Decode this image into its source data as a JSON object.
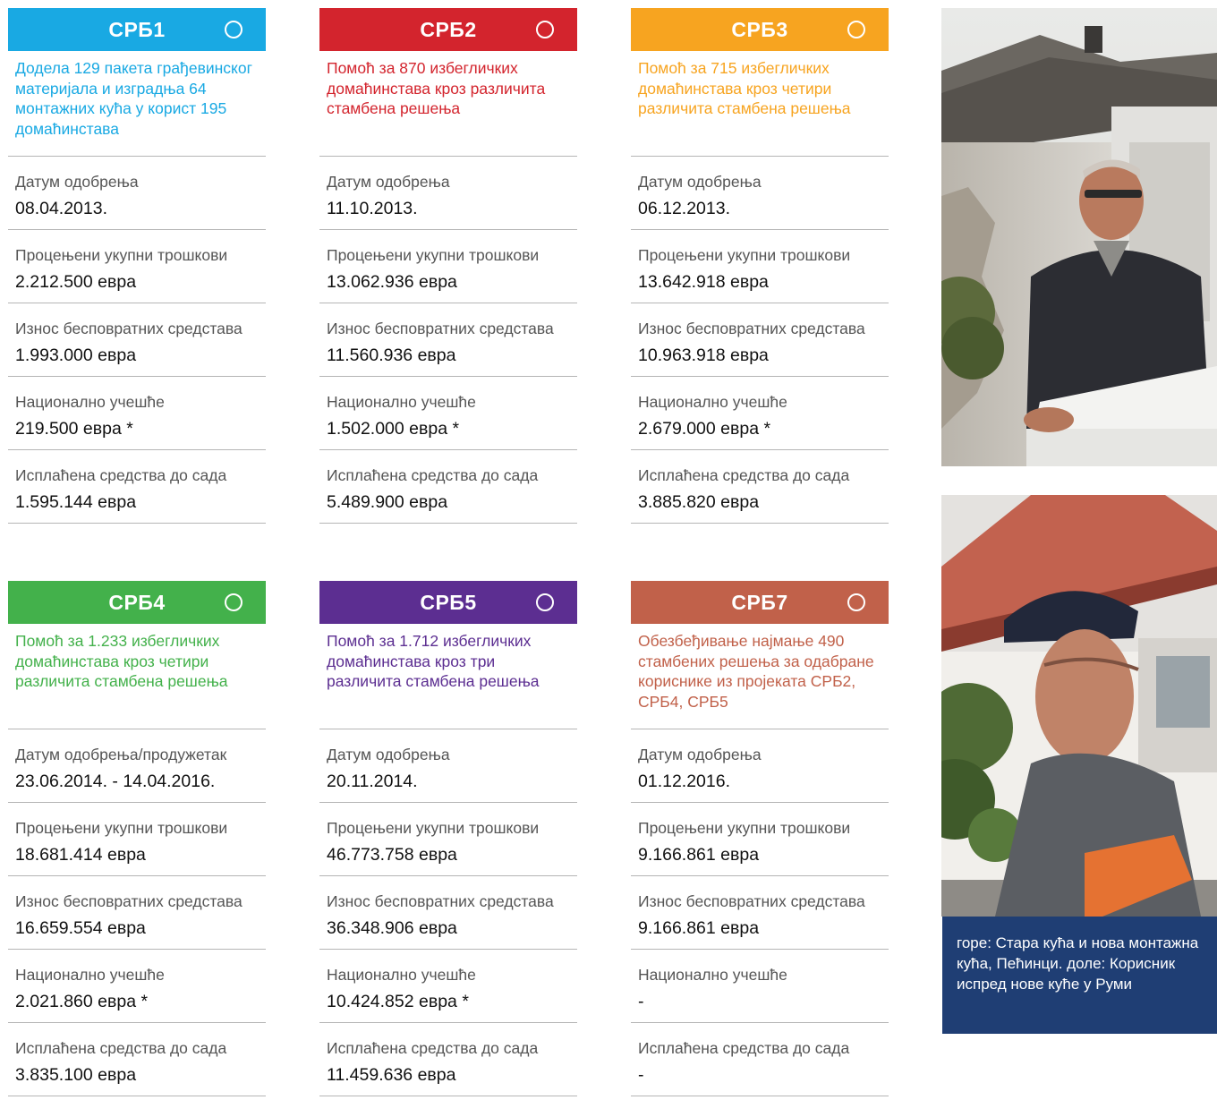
{
  "cards": [
    {
      "code": "СРБ1",
      "color": "#19a9e3",
      "description": "Додела 129 пакета грађевинског материјала и изградња 64 монтажних кућа у корист 195 домаћинстава",
      "fields": [
        {
          "label": "Датум одобрења",
          "value": "08.04.2013."
        },
        {
          "label": "Процењени укупни трошкови",
          "value": "2.212.500 евра"
        },
        {
          "label": "Износ бесповратних средстава",
          "value": "1.993.000 евра"
        },
        {
          "label": "Национално учешће",
          "value": "219.500 евра *"
        },
        {
          "label": "Исплаћена средства  до сада",
          "value": "1.595.144 евра"
        }
      ]
    },
    {
      "code": "СРБ2",
      "color": "#d3242d",
      "description": "Помоћ за 870 избегличких домаћинстава кроз различита стамбена решења",
      "fields": [
        {
          "label": "Датум одобрења",
          "value": "11.10.2013."
        },
        {
          "label": "Процењени укупни трошкови",
          "value": "13.062.936 евра"
        },
        {
          "label": "Износ бесповратних средстава",
          "value": "11.560.936 евра"
        },
        {
          "label": "Национално учешће",
          "value": "1.502.000 евра *"
        },
        {
          "label": "Исплаћена средства  до сада",
          "value": "5.489.900 евра"
        }
      ]
    },
    {
      "code": "СРБ3",
      "color": "#f7a420",
      "description": "Помоћ за 715 избегличких домаћинстава кроз четири различита стамбена решења",
      "fields": [
        {
          "label": "Датум одобрења",
          "value": "06.12.2013."
        },
        {
          "label": "Процењени укупни трошкови",
          "value": "13.642.918 евра"
        },
        {
          "label": "Износ бесповратних средстава",
          "value": "10.963.918 евра"
        },
        {
          "label": "Национално учешће",
          "value": "2.679.000 евра *"
        },
        {
          "label": "Исплаћена средства  до сада",
          "value": "3.885.820 евра"
        }
      ]
    },
    {
      "code": "СРБ4",
      "color": "#43b14b",
      "description": "Помоћ за 1.233 избегличких домаћинстава кроз четири различита стамбена решења",
      "fields": [
        {
          "label": "Датум одобрења/продужетак",
          "value": "23.06.2014.  -  14.04.2016."
        },
        {
          "label": "Процењени укупни трошкови",
          "value": "18.681.414 евра"
        },
        {
          "label": "Износ бесповратних средстава",
          "value": "16.659.554 евра"
        },
        {
          "label": "Национално учешће",
          "value": "2.021.860 евра *"
        },
        {
          "label": "Исплаћена средства  до сада",
          "value": "3.835.100 евра"
        }
      ]
    },
    {
      "code": "СРБ5",
      "color": "#5c2e91",
      "description": "Помоћ за 1.712 избегличких домаћинстава кроз три различита стамбена решења",
      "fields": [
        {
          "label": "Датум одобрења",
          "value": "20.11.2014."
        },
        {
          "label": "Процењени укупни трошкови",
          "value": "46.773.758 евра"
        },
        {
          "label": "Износ бесповратних средстава",
          "value": "36.348.906 евра"
        },
        {
          "label": "Национално учешће",
          "value": "10.424.852 евра *"
        },
        {
          "label": "Исплаћена средства  до сада",
          "value": "11.459.636 евра"
        }
      ]
    },
    {
      "code": "СРБ7",
      "color": "#c1614a",
      "description": "Обезбеђивање најмање 490 стамбених решења за одабране кориснике из пројеката СРБ2, СРБ4, СРБ5",
      "fields": [
        {
          "label": "Датум одобрења",
          "value": "01.12.2016."
        },
        {
          "label": "Процењени укупни трошкови",
          "value": "9.166.861 евра"
        },
        {
          "label": "Износ бесповратних средстава",
          "value": "9.166.861 евра"
        },
        {
          "label": "Национално учешће",
          "value": "-"
        },
        {
          "label": "Исплаћена средства  до сада",
          "value": "-"
        }
      ]
    }
  ],
  "caption": "горе: Стара кућа и нова монтажна кућа, Пећинци. доле: Корисник испред нове куће у Руми",
  "colors": {
    "caption_bg": "#1f3e74",
    "divider": "#b5b5b5"
  }
}
